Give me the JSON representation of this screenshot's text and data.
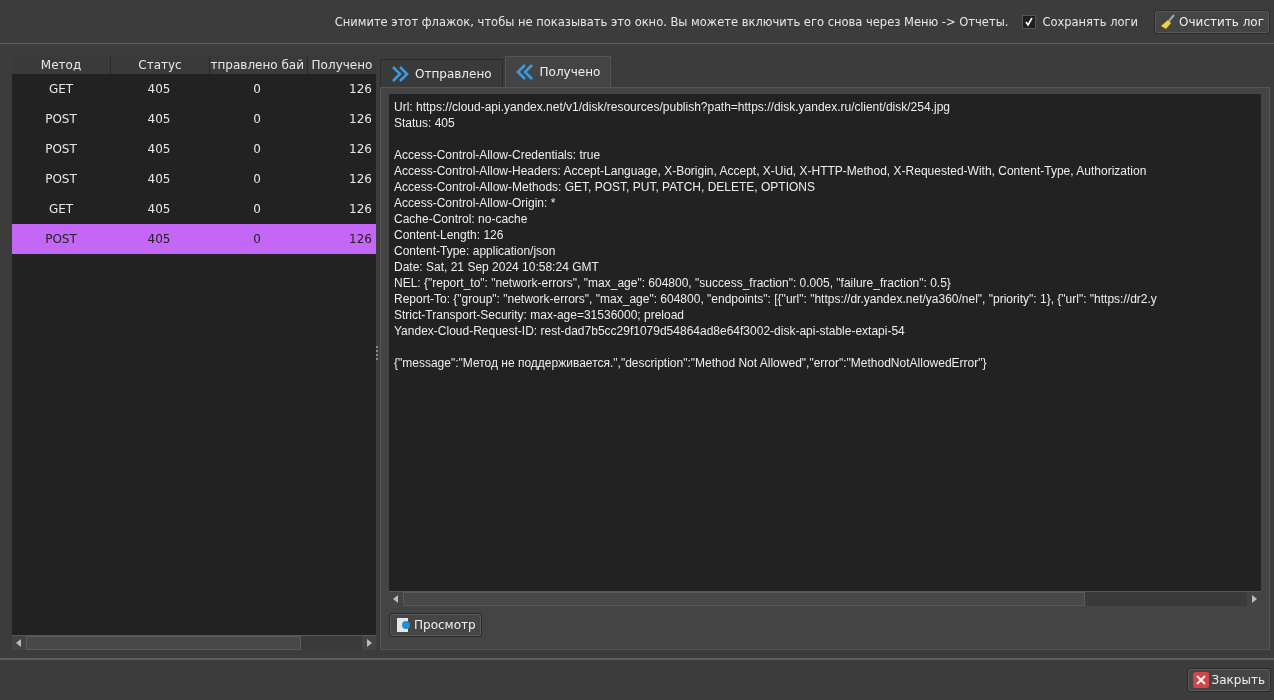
{
  "top_bar": {
    "hint": "Снимите этот флажок, чтобы не показывать это окно. Вы можете включить его снова через Меню -> Отчеты.",
    "save_logs": {
      "label": "Сохранять логи",
      "checked": true
    },
    "clear_button": "Очистить лог"
  },
  "table": {
    "columns": [
      "Метод",
      "Статус",
      "тправлено бай",
      "Получено"
    ],
    "rows": [
      {
        "method": "GET",
        "status": "405",
        "sent": "0",
        "received": "126",
        "selected": false
      },
      {
        "method": "POST",
        "status": "405",
        "sent": "0",
        "received": "126",
        "selected": false
      },
      {
        "method": "POST",
        "status": "405",
        "sent": "0",
        "received": "126",
        "selected": false
      },
      {
        "method": "POST",
        "status": "405",
        "sent": "0",
        "received": "126",
        "selected": false
      },
      {
        "method": "GET",
        "status": "405",
        "sent": "0",
        "received": "126",
        "selected": false
      },
      {
        "method": "POST",
        "status": "405",
        "sent": "0",
        "received": "126",
        "selected": true
      }
    ]
  },
  "tabs": [
    {
      "label": "Отправлено",
      "kind": "sent",
      "selected": false
    },
    {
      "label": "Получено",
      "kind": "received",
      "selected": true
    }
  ],
  "response": {
    "blocks": [
      [
        "Url: https://cloud-api.yandex.net/v1/disk/resources/publish?path=https://disk.yandex.ru/client/disk/254.jpg",
        "Status: 405"
      ],
      [
        "Access-Control-Allow-Credentials: true",
        "Access-Control-Allow-Headers: Accept-Language, X-Borigin, Accept, X-Uid, X-HTTP-Method, X-Requested-With, Content-Type, Authorization",
        "Access-Control-Allow-Methods: GET, POST, PUT, PATCH, DELETE, OPTIONS",
        "Access-Control-Allow-Origin: *",
        "Cache-Control: no-cache",
        "Content-Length: 126",
        "Content-Type: application/json",
        "Date: Sat, 21 Sep 2024 10:58:24 GMT",
        "NEL: {\"report_to\": \"network-errors\", \"max_age\": 604800, \"success_fraction\": 0.005, \"failure_fraction\": 0.5}",
        "Report-To: {\"group\": \"network-errors\", \"max_age\": 604800, \"endpoints\": [{\"url\": \"https://dr.yandex.net/ya360/nel\", \"priority\": 1}, {\"url\": \"https://dr2.y",
        "Strict-Transport-Security: max-age=31536000; preload",
        "Yandex-Cloud-Request-ID: rest-dad7b5cc29f1079d54864ad8e64f3002-disk-api-stable-extapi-54"
      ],
      [
        "{\"message\":\"Метод не поддерживается.\",\"description\":\"Method Not Allowed\",\"error\":\"MethodNotAllowedError\"}"
      ]
    ]
  },
  "preview_button": "Просмотр",
  "close_button": "Закрыть"
}
